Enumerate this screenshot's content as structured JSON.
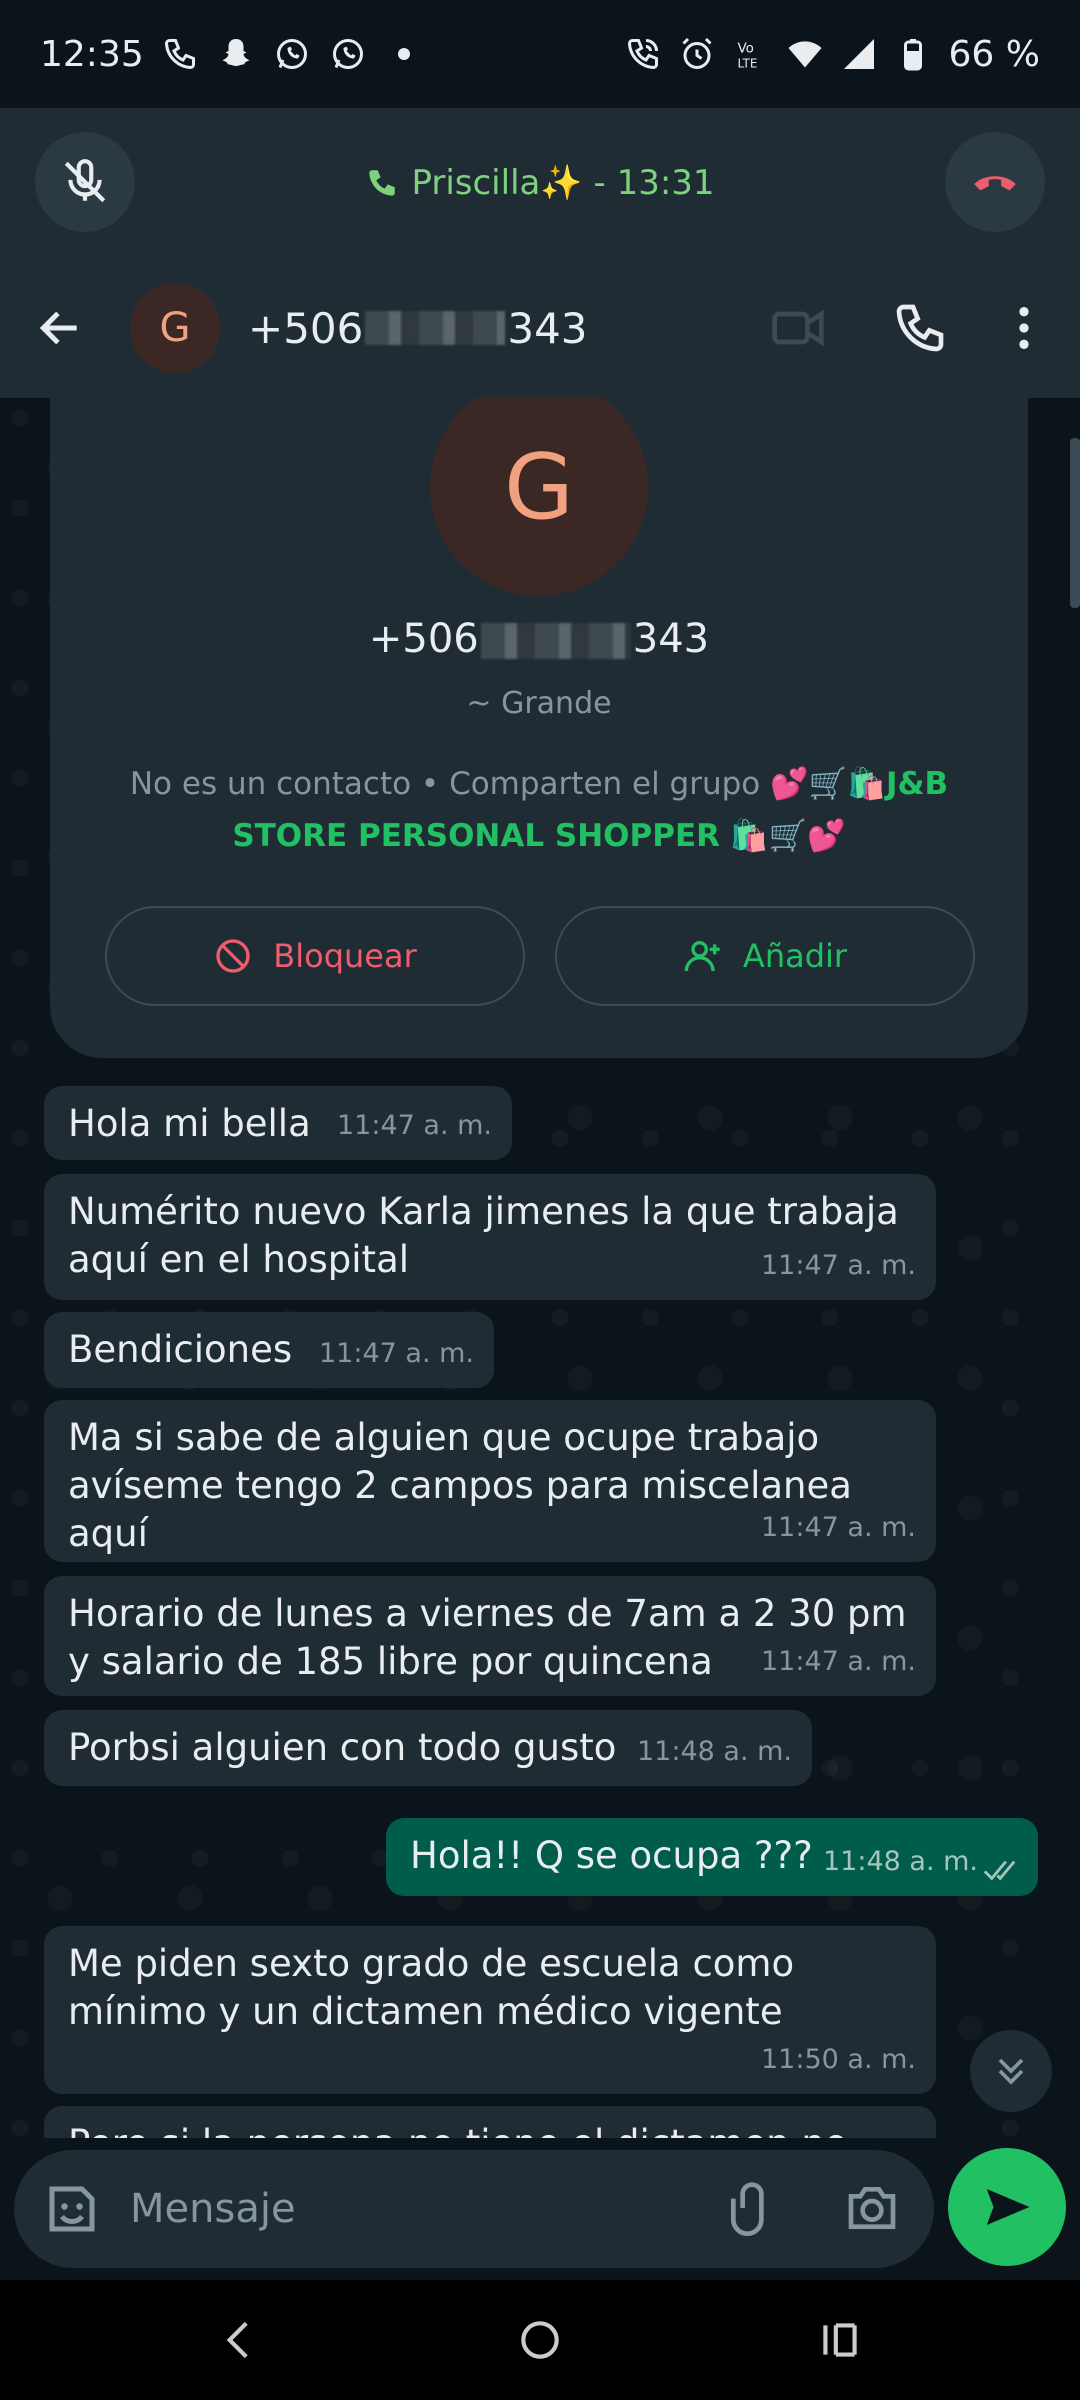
{
  "status_bar": {
    "time": "12:35",
    "battery": "66 %"
  },
  "call_bar": {
    "label": "Priscilla✨ - 13:31"
  },
  "header": {
    "avatar_letter": "G",
    "number_prefix": "+506",
    "number_suffix": "343"
  },
  "contact_card": {
    "avatar_letter": "G",
    "number_prefix": "+506",
    "number_suffix": "343",
    "push_name": "~ Grande",
    "desc_prefix": "No es un contacto • Comparten el grupo 💕🛒🛍️",
    "group_name": "J&B STORE PERSONAL SHOPPER",
    "desc_suffix": " 🛍️🛒💕",
    "block_label": "Bloquear",
    "add_label": "Añadir"
  },
  "messages": [
    {
      "text": "Hola mi bella",
      "time": "11:47 a. m."
    },
    {
      "text": "Numérito nuevo Karla jimenes la que trabaja aquí en el hospital",
      "time": "11:47 a. m."
    },
    {
      "text": "Bendiciones",
      "time": "11:47 a. m."
    },
    {
      "text": "Ma si sabe de alguien que ocupe trabajo avíseme tengo 2 campos para miscelanea aquí",
      "time": "11:47 a. m."
    },
    {
      "text": "Horario de lunes a viernes de 7am a 2 30 pm y salario de 185 libre por quincena",
      "time": "11:47 a. m."
    },
    {
      "text": "Porbsi alguien con todo gusto",
      "time": "11:48 a. m."
    },
    {
      "text": "Hola!! Q se ocupa ???",
      "time": "11:48 a. m.",
      "outgoing": true
    },
    {
      "text": "Me piden sexto grado de escuela como mínimo y un dictamen médico vigente",
      "time": "11:50 a. m."
    },
    {
      "text": "Pero si la persona no tiene el dictamen no hay",
      "time": ""
    }
  ],
  "composer": {
    "placeholder": "Mensaje"
  }
}
